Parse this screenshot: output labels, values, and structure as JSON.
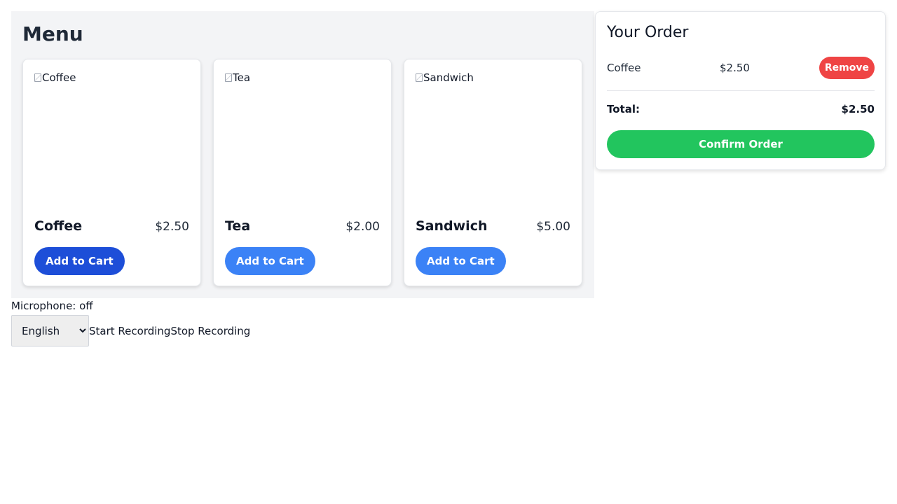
{
  "menu": {
    "title": "Menu",
    "items": [
      {
        "image_alt": "Coffee",
        "name": "Coffee",
        "price": "$2.50",
        "add_label": "Add to Cart"
      },
      {
        "image_alt": "Tea",
        "name": "Tea",
        "price": "$2.00",
        "add_label": "Add to Cart"
      },
      {
        "image_alt": "Sandwich",
        "name": "Sandwich",
        "price": "$5.00",
        "add_label": "Add to Cart"
      }
    ]
  },
  "order": {
    "title": "Your Order",
    "items": [
      {
        "name": "Coffee",
        "price": "$2.50",
        "remove_label": "Remove"
      }
    ],
    "total_label": "Total:",
    "total_value": "$2.50",
    "confirm_label": "Confirm Order"
  },
  "voice": {
    "microphone_status": "Microphone: off",
    "language": {
      "selected": "English"
    },
    "start_label": "Start Recording",
    "stop_label": "Stop Recording"
  },
  "colors": {
    "primary_blue": "#3b82f6",
    "active_blue": "#1d4ed8",
    "confirm_green": "#22c55e",
    "remove_red": "#ef4444",
    "panel_gray": "#f3f4f6"
  },
  "icons": {
    "broken_image": "broken-image-icon",
    "select_arrow": "chevron-down-icon"
  }
}
